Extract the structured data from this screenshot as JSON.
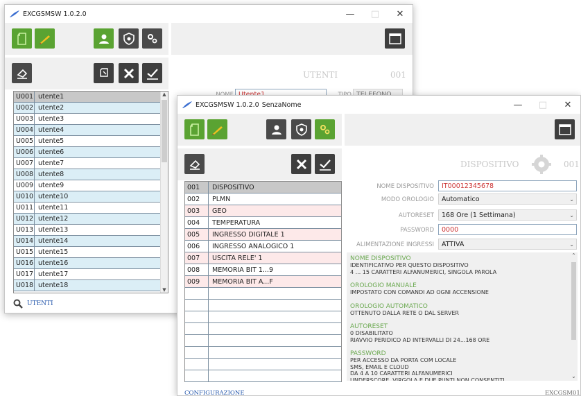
{
  "back_window": {
    "app_title": "EXCGSMSW 1.0.2.0",
    "section_title": "UTENTI",
    "section_number": "001",
    "fields": {
      "name_label": "NOME",
      "name_value": "Utente1",
      "type_label": "TIPO",
      "type_value": "TELEFONO"
    },
    "users": [
      {
        "code": "U001",
        "name": "utente1"
      },
      {
        "code": "U002",
        "name": "utente2"
      },
      {
        "code": "U003",
        "name": "utente3"
      },
      {
        "code": "U004",
        "name": "utente4"
      },
      {
        "code": "U005",
        "name": "utente5"
      },
      {
        "code": "U006",
        "name": "utente6"
      },
      {
        "code": "U007",
        "name": "utente7"
      },
      {
        "code": "U008",
        "name": "utente8"
      },
      {
        "code": "U009",
        "name": "utente9"
      },
      {
        "code": "U010",
        "name": "utente10"
      },
      {
        "code": "U011",
        "name": "utente11"
      },
      {
        "code": "U012",
        "name": "utente12"
      },
      {
        "code": "U013",
        "name": "utente13"
      },
      {
        "code": "U014",
        "name": "utente14"
      },
      {
        "code": "U015",
        "name": "utente15"
      },
      {
        "code": "U016",
        "name": "utente16"
      },
      {
        "code": "U017",
        "name": "utente17"
      },
      {
        "code": "U018",
        "name": "utente18"
      }
    ],
    "search_label": "UTENTI"
  },
  "front_window": {
    "app_title": "EXCGSMSW 1.0.2.0",
    "doc_title": "SenzaNome",
    "section_title": "DISPOSITIVO",
    "section_number": "001",
    "menu_items": [
      {
        "code": "001",
        "name": "DISPOSITIVO"
      },
      {
        "code": "002",
        "name": "PLMN"
      },
      {
        "code": "003",
        "name": "GEO"
      },
      {
        "code": "004",
        "name": "TEMPERATURA"
      },
      {
        "code": "005",
        "name": "INGRESSO DIGITALE 1"
      },
      {
        "code": "006",
        "name": "INGRESSO ANALOGICO 1"
      },
      {
        "code": "007",
        "name": "USCITA RELE' 1"
      },
      {
        "code": "008",
        "name": "MEMORIA BIT 1...9"
      },
      {
        "code": "009",
        "name": "MEMORIA BIT A...F"
      }
    ],
    "form": {
      "device_name_label": "NOME DISPOSITIVO",
      "device_name_value": "IT00012345678",
      "clock_mode_label": "MODO OROLOGIO",
      "clock_mode_value": "Automatico",
      "autoreset_label": "AUTORESET",
      "autoreset_value": "168 Ore (1 Settimana)",
      "password_label": "PASSWORD",
      "password_value": "0000",
      "input_power_label": "ALIMENTAZIONE INGRESSI",
      "input_power_value": "ATTIVA"
    },
    "help": [
      {
        "heading": "NOME DISPOSITIVO",
        "lines": [
          "IDENTIFICATIVO PER QUESTO DISPOSITIVO",
          "4 ... 15 CARATTERI ALFANUMERICI, SINGOLA PAROLA"
        ]
      },
      {
        "heading": "OROLOGIO MANUALE",
        "lines": [
          "IMPOSTATO CON COMANDI AD OGNI ACCENSIONE"
        ]
      },
      {
        "heading": "OROLOGIO AUTOMATICO",
        "lines": [
          "OTTENUTO DALLA RETE O DAL SERVER"
        ]
      },
      {
        "heading": "AUTORESET",
        "lines": [
          "0  DISABILITATO",
          "RIAVVIO PERIDICO AD INTERVALLI DI 24...168 ORE"
        ]
      },
      {
        "heading": "PASSWORD",
        "lines": [
          "PER ACCESSO DA PORTA COM LOCALE",
          "SMS, EMAIL E CLOUD",
          "DA 4 A 10 CARATTERI ALFANUMERICI",
          "UNDERSCORE, VIRGOLA E DUE PUNTI NON CONSENTITI"
        ]
      }
    ],
    "footer_left": "CONFIGURAZIONE",
    "footer_right": "EXCGSM01"
  },
  "colors": {
    "accent_green": "#5aa332",
    "accent_blue": "#2255aa",
    "row_blue": "#dbeef6",
    "row_pink": "#fde9e9",
    "selected_row": "#c8c8c8"
  }
}
